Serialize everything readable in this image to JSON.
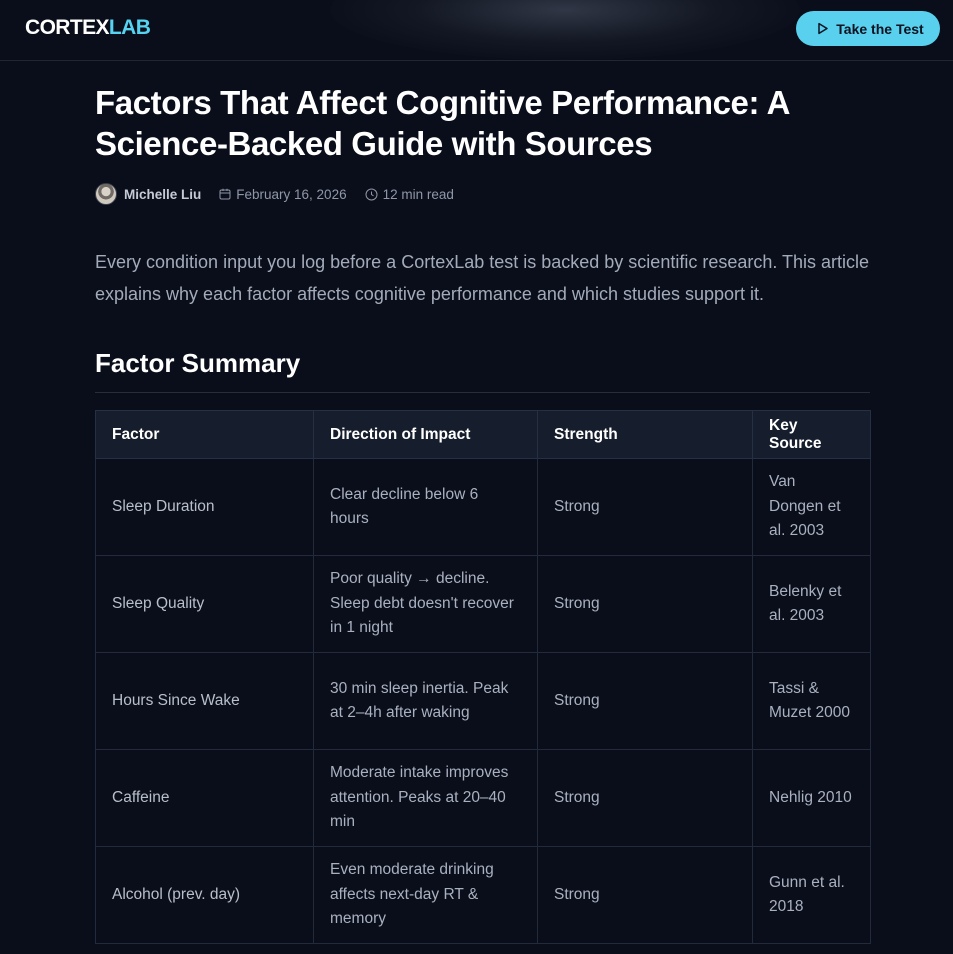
{
  "header": {
    "logo_part1": "CORTEX",
    "logo_part2": "LAB",
    "cta_label": "Take the Test"
  },
  "article": {
    "title": "Factors That Affect Cognitive Performance: A Science-Backed Guide with Sources",
    "author": "Michelle Liu",
    "date": "February 16, 2026",
    "read_time": "12 min read",
    "intro": "Every condition input you log before a CortexLab test is backed by scientific research. This article explains why each factor affects cognitive performance and which studies support it."
  },
  "summary": {
    "heading": "Factor Summary",
    "columns": [
      "Factor",
      "Direction of Impact",
      "Strength",
      "Key Source"
    ],
    "rows": [
      [
        "Sleep Duration",
        "Clear decline below 6 hours",
        "Strong",
        "Van Dongen et al. 2003"
      ],
      [
        "Sleep Quality",
        "Poor quality → decline. Sleep debt doesn't recover in 1 night",
        "Strong",
        "Belenky et al. 2003"
      ],
      [
        "Hours Since Wake",
        "30 min sleep inertia. Peak at 2–4h after waking",
        "Strong",
        "Tassi & Muzet 2000"
      ],
      [
        "Caffeine",
        "Moderate intake improves attention. Peaks at 20–40 min",
        "Strong",
        "Nehlig 2010"
      ],
      [
        "Alcohol (prev. day)",
        "Even moderate drinking affects next-day RT & memory",
        "Strong",
        "Gunn et al. 2018"
      ]
    ]
  },
  "colors": {
    "background": "#0a0e1a",
    "accent": "#58d0ee",
    "table_header_bg": "#161d2d"
  },
  "icons": {
    "cta": "play-icon",
    "date": "calendar-icon",
    "read_time": "clock-icon"
  }
}
